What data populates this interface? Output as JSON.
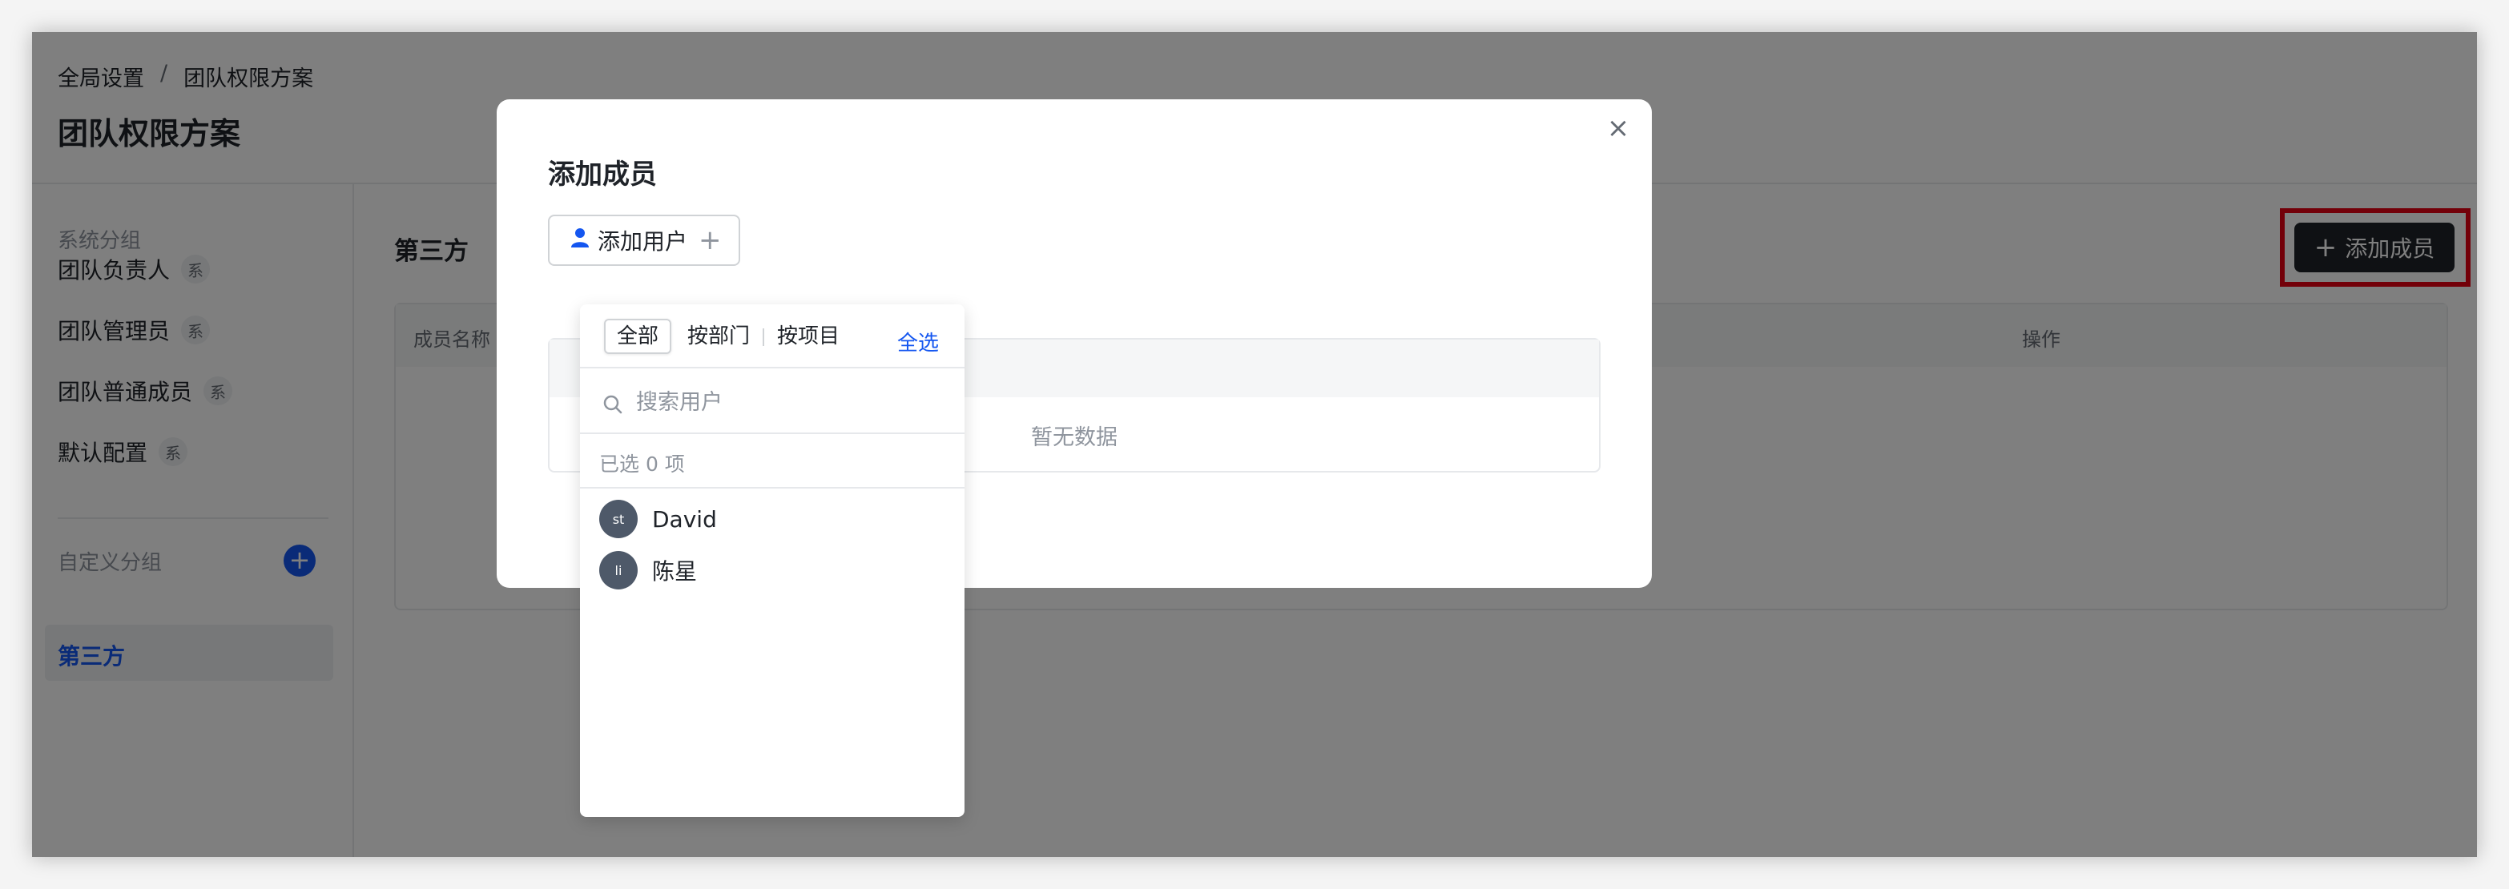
{
  "breadcrumb": {
    "root": "全局设置",
    "separator": "/",
    "current": "团队权限方案"
  },
  "page_title": "团队权限方案",
  "sidebar": {
    "system_group_title": "系统分组",
    "system_items": [
      {
        "label": "团队负责人",
        "tag": "系"
      },
      {
        "label": "团队管理员",
        "tag": "系"
      },
      {
        "label": "团队普通成员",
        "tag": "系"
      },
      {
        "label": "默认配置",
        "tag": "系"
      }
    ],
    "custom_group_title": "自定义分组",
    "add_group_symbol": "+",
    "custom_items": [
      {
        "label": "第三方"
      }
    ]
  },
  "main": {
    "title": "第三方",
    "add_member_button": "添加成员",
    "add_member_icon": "+",
    "columns": [
      "成员名称",
      "操作"
    ]
  },
  "modal": {
    "title": "添加成员",
    "close_symbol": "×",
    "add_user_button": "添加用户",
    "add_user_plus": "+",
    "empty_text": "暂无数据"
  },
  "dropdown": {
    "tabs": [
      "全部",
      "按部门",
      "按项目"
    ],
    "active_tab": "全部",
    "select_all": "全选",
    "search_placeholder": "搜索用户",
    "selected_count": "已选 0 项",
    "users": [
      {
        "avatar": "st",
        "name": "David"
      },
      {
        "avatar": "li",
        "name": "陈星"
      }
    ]
  },
  "colors": {
    "accent": "#1456f0",
    "dark_button": "#1f2329",
    "highlight": "#e60012"
  }
}
